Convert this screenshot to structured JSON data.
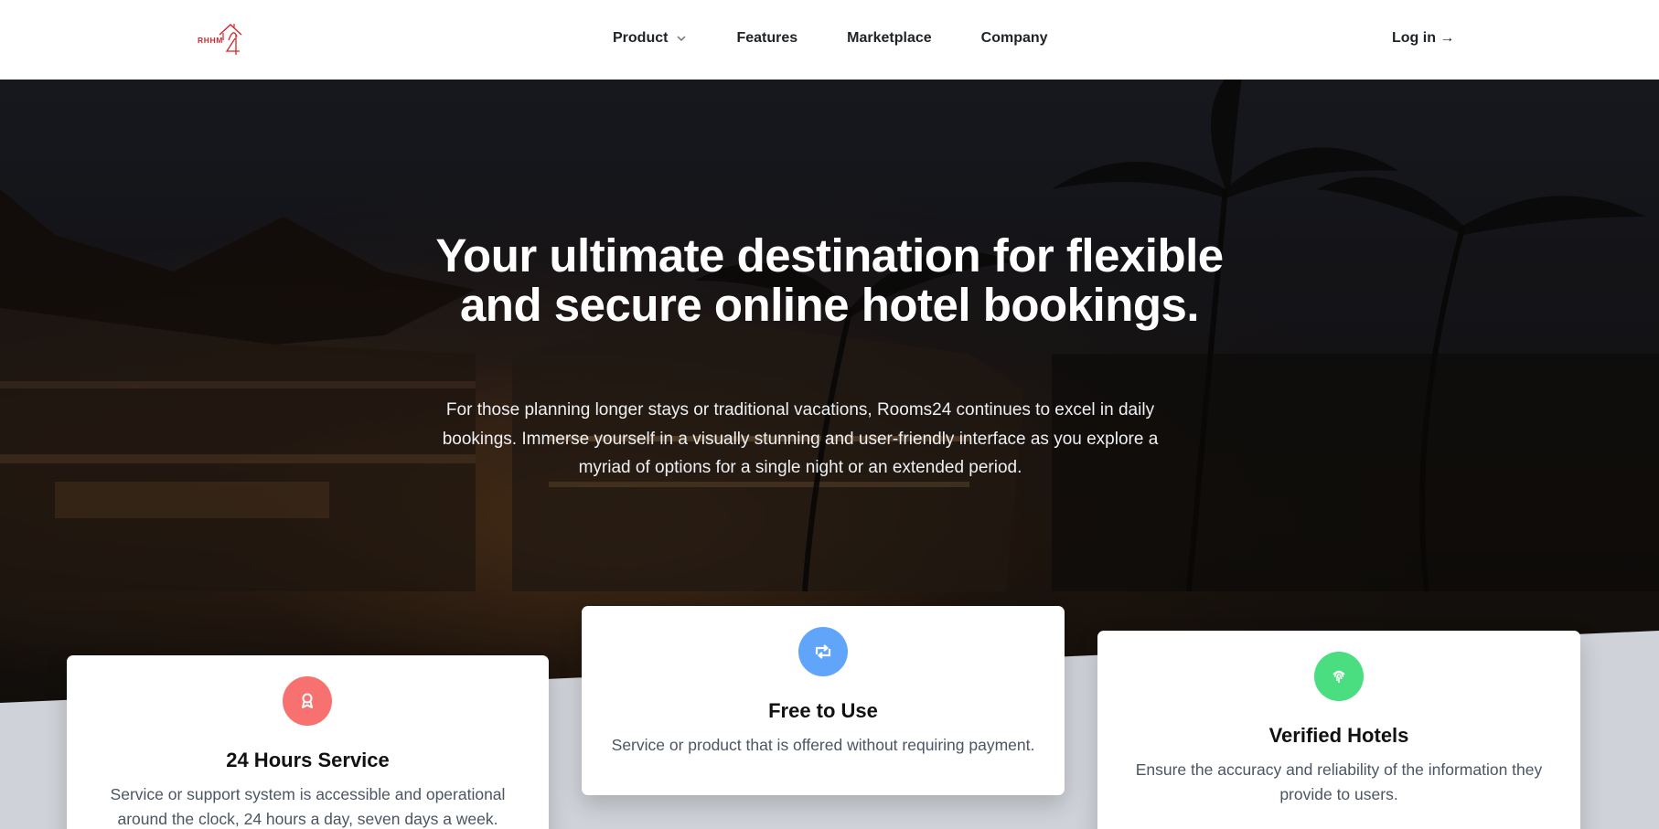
{
  "brand": {
    "logo_text": "RHHM",
    "logo_icon": "house-24-logo-icon",
    "logo_color": "#d3262c"
  },
  "nav": {
    "items": [
      {
        "label": "Product",
        "has_dropdown": true
      },
      {
        "label": "Features"
      },
      {
        "label": "Marketplace"
      },
      {
        "label": "Company"
      }
    ],
    "login_label": "Log in →"
  },
  "hero": {
    "title": "Your ultimate destination for flexible and secure online hotel bookings.",
    "subtitle": "For those planning longer stays or traditional vacations, Rooms24 continues to excel in daily bookings. Immerse yourself in a visually stunning and user-friendly interface as you explore a myriad of options for a single night or an extended period."
  },
  "features": [
    {
      "title": "24 Hours Service",
      "text": "Service or support system is accessible and operational around the clock, 24 hours a day, seven days a week.",
      "icon": "award-icon",
      "color": "#f87171"
    },
    {
      "title": "Free to Use",
      "text": "Service or product that is offered without requiring payment.",
      "icon": "retweet-icon",
      "color": "#60a5fa"
    },
    {
      "title": "Verified Hotels",
      "text": "Ensure the accuracy and reliability of the information they provide to users.",
      "icon": "fingerprint-icon",
      "color": "#4ade80"
    }
  ],
  "colors": {
    "background": "#cfd2d8",
    "nav_bg": "#ffffff",
    "text_dark": "#1f2328"
  }
}
